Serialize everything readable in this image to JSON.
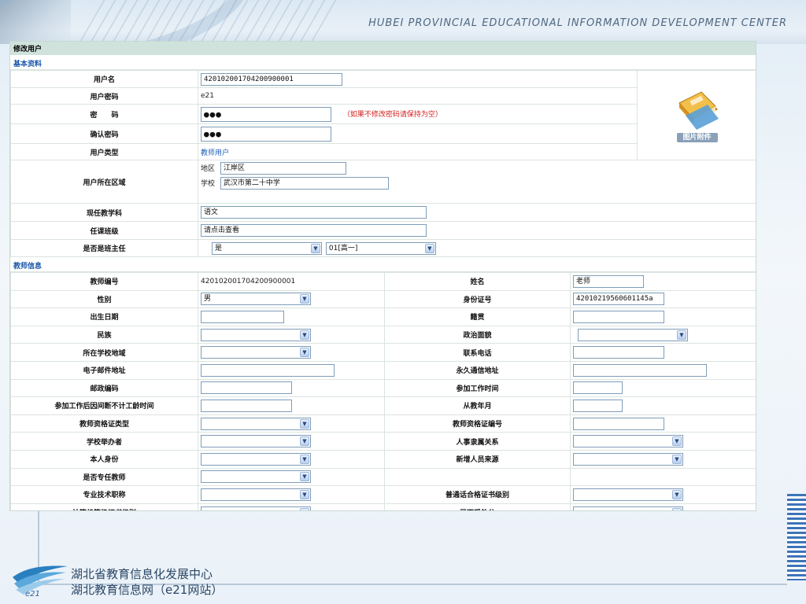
{
  "banner": {
    "text": "HUBEI PROVINCIAL EDUCATIONAL INFORMATION DEVELOPMENT CENTER"
  },
  "footer": {
    "line1": "湖北省教育信息化发展中心",
    "line2": "湖北教育信息网（e21网站）",
    "logo_text": "e21"
  },
  "form": {
    "title": "修改用户",
    "basic_section": "基本资料",
    "teacher_section": "教师信息",
    "photo_label": "图片附件",
    "basic": {
      "username_label": "用户名",
      "username_value": "420102001704200900001",
      "userpwd_label": "用户密码",
      "userpwd_value": "e21",
      "password_label": "密　　码",
      "password_value": "●●●",
      "password_hint": "（如果不修改密码请保持为空）",
      "confirm_label": "确认密码",
      "confirm_value": "●●●",
      "usertype_label": "用户类型",
      "usertype_value": "教师用户",
      "region_label": "用户所在区域",
      "district_key": "地区",
      "district_value": "江岸区",
      "school_key": "学校",
      "school_value": "武汉市第二十中学",
      "subject_label": "现任教学科",
      "subject_value": "语文",
      "class_label": "任课班级",
      "class_value": "请点击查看",
      "headteacher_label": "是否是班主任",
      "headteacher_value": "是",
      "headteacher_class": "01[高一]"
    },
    "teacher": {
      "rows": [
        {
          "l1": "教师编号",
          "v1": "420102001704200900001",
          "t1": "text",
          "l2": "姓名",
          "v2": "老师",
          "t2": "input",
          "w2": 90
        },
        {
          "l1": "性别",
          "v1": "男",
          "t1": "select",
          "l2": "身份证号",
          "v2": "42010219560601145a",
          "t2": "input",
          "w2": 116
        },
        {
          "l1": "出生日期",
          "v1": "",
          "t1": "input",
          "w1": 106,
          "l2": "籍贯",
          "v2": "",
          "t2": "input",
          "w2": 116
        },
        {
          "l1": "民族",
          "v1": "",
          "t1": "select",
          "l2": "政治面貌",
          "v2": "",
          "t2": "select",
          "w2": 140,
          "o2": 6
        },
        {
          "l1": "所在学校地域",
          "v1": "",
          "t1": "select",
          "l2": "联系电话",
          "v2": "",
          "t2": "input",
          "w2": 116
        },
        {
          "l1": "电子邮件地址",
          "v1": "",
          "t1": "input",
          "w1": 170,
          "l2": "永久通信地址",
          "v2": "",
          "t2": "input",
          "w2": 170
        },
        {
          "l1": "邮政编码",
          "v1": "",
          "t1": "input",
          "w1": 116,
          "l2": "参加工作时间",
          "v2": "",
          "t2": "input",
          "w2": 63
        },
        {
          "l1": "参加工作后因间断不计工龄时间",
          "v1": "",
          "t1": "input",
          "w1": 116,
          "l2": "从教年月",
          "v2": "",
          "t2": "input",
          "w2": 63
        },
        {
          "l1": "教师资格证类型",
          "v1": "",
          "t1": "select",
          "l2": "教师资格证编号",
          "v2": "",
          "t2": "input",
          "w2": 116
        },
        {
          "l1": "学校举办者",
          "v1": "",
          "t1": "select",
          "l2": "人事隶属关系",
          "v2": "",
          "t2": "select",
          "w2": 140
        },
        {
          "l1": "本人身份",
          "v1": "",
          "t1": "select",
          "l2": "新增人员来源",
          "v2": "",
          "t2": "select",
          "w2": 140
        },
        {
          "l1": "是否专任教师",
          "v1": "",
          "t1": "select",
          "l2": "",
          "v2": "",
          "t2": "none"
        },
        {
          "l1": "专业技术职称",
          "v1": "",
          "t1": "select",
          "l2": "普通话合格证书级别",
          "v2": "",
          "t2": "select",
          "w2": 140
        },
        {
          "l1": "计算机等级证书级别",
          "v1": "",
          "t1": "select",
          "l2": "是否受处分",
          "v2": "",
          "t2": "select",
          "w2": 140
        }
      ]
    }
  },
  "icons": {
    "dropdown": "chevron-down-icon",
    "photo": "book-icon"
  },
  "colors": {
    "title_bar": "#cfe3dc",
    "section_text": "#1a56a8",
    "warn": "#d42020",
    "banner_text": "#4f6882"
  }
}
